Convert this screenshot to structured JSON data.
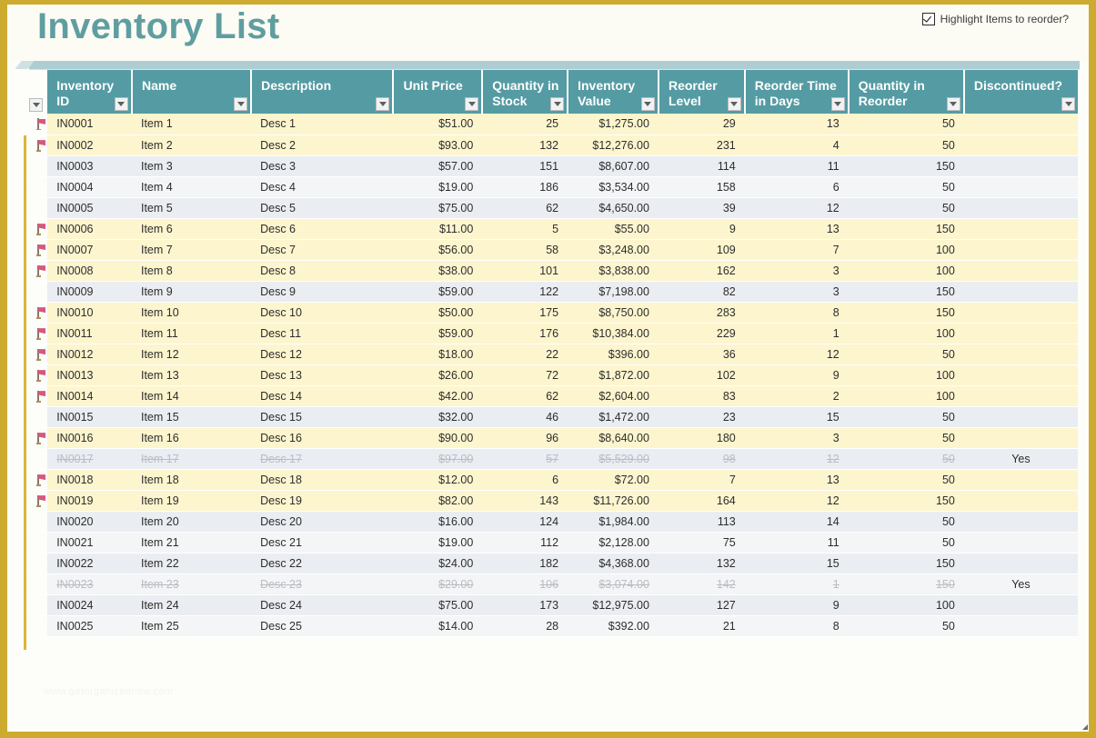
{
  "page": {
    "title": "Inventory List",
    "watermark": "www.getorganizednow.com",
    "accent_teal": "#559ba3",
    "title_color": "#5f9ea0",
    "frame_color": "#cdab2e",
    "highlight_row_color": "#fdf5ce",
    "alt_row_color": "#eaedf1"
  },
  "highlight_toggle": {
    "label": "Highlight Items to reorder?",
    "checked": true,
    "icon": "checkbox-checked-icon"
  },
  "table": {
    "columns": [
      {
        "key": "flag",
        "label": "",
        "align": "center"
      },
      {
        "key": "inventory_id",
        "label": "Inventory ID",
        "align": "left"
      },
      {
        "key": "name",
        "label": "Name",
        "align": "left"
      },
      {
        "key": "description",
        "label": "Description",
        "align": "left"
      },
      {
        "key": "unit_price",
        "label": "Unit Price",
        "align": "right"
      },
      {
        "key": "quantity_in_stock",
        "label": "Quantity in Stock",
        "align": "right"
      },
      {
        "key": "inventory_value",
        "label": "Inventory Value",
        "align": "right"
      },
      {
        "key": "reorder_level",
        "label": "Reorder Level",
        "align": "right"
      },
      {
        "key": "reorder_time_in_days",
        "label": "Reorder Time in Days",
        "align": "right"
      },
      {
        "key": "quantity_in_reorder",
        "label": "Quantity in Reorder",
        "align": "right"
      },
      {
        "key": "discontinued",
        "label": "Discontinued?",
        "align": "center"
      }
    ],
    "filter_icon": "filter-dropdown-icon",
    "flag_icon": "reorder-flag-icon",
    "rows": [
      {
        "flag": true,
        "inventory_id": "IN0001",
        "name": "Item 1",
        "description": "Desc 1",
        "unit_price": "$51.00",
        "quantity_in_stock": "25",
        "inventory_value": "$1,275.00",
        "reorder_level": "29",
        "reorder_time_in_days": "13",
        "quantity_in_reorder": "50",
        "discontinued": "",
        "style": "hl"
      },
      {
        "flag": true,
        "inventory_id": "IN0002",
        "name": "Item 2",
        "description": "Desc 2",
        "unit_price": "$93.00",
        "quantity_in_stock": "132",
        "inventory_value": "$12,276.00",
        "reorder_level": "231",
        "reorder_time_in_days": "4",
        "quantity_in_reorder": "50",
        "discontinued": "",
        "style": "hl"
      },
      {
        "flag": false,
        "inventory_id": "IN0003",
        "name": "Item 3",
        "description": "Desc 3",
        "unit_price": "$57.00",
        "quantity_in_stock": "151",
        "inventory_value": "$8,607.00",
        "reorder_level": "114",
        "reorder_time_in_days": "11",
        "quantity_in_reorder": "150",
        "discontinued": "",
        "style": "alt"
      },
      {
        "flag": false,
        "inventory_id": "IN0004",
        "name": "Item 4",
        "description": "Desc 4",
        "unit_price": "$19.00",
        "quantity_in_stock": "186",
        "inventory_value": "$3,534.00",
        "reorder_level": "158",
        "reorder_time_in_days": "6",
        "quantity_in_reorder": "50",
        "discontinued": "",
        "style": "plain"
      },
      {
        "flag": false,
        "inventory_id": "IN0005",
        "name": "Item 5",
        "description": "Desc 5",
        "unit_price": "$75.00",
        "quantity_in_stock": "62",
        "inventory_value": "$4,650.00",
        "reorder_level": "39",
        "reorder_time_in_days": "12",
        "quantity_in_reorder": "50",
        "discontinued": "",
        "style": "alt"
      },
      {
        "flag": true,
        "inventory_id": "IN0006",
        "name": "Item 6",
        "description": "Desc 6",
        "unit_price": "$11.00",
        "quantity_in_stock": "5",
        "inventory_value": "$55.00",
        "reorder_level": "9",
        "reorder_time_in_days": "13",
        "quantity_in_reorder": "150",
        "discontinued": "",
        "style": "hl"
      },
      {
        "flag": true,
        "inventory_id": "IN0007",
        "name": "Item 7",
        "description": "Desc 7",
        "unit_price": "$56.00",
        "quantity_in_stock": "58",
        "inventory_value": "$3,248.00",
        "reorder_level": "109",
        "reorder_time_in_days": "7",
        "quantity_in_reorder": "100",
        "discontinued": "",
        "style": "hl"
      },
      {
        "flag": true,
        "inventory_id": "IN0008",
        "name": "Item 8",
        "description": "Desc 8",
        "unit_price": "$38.00",
        "quantity_in_stock": "101",
        "inventory_value": "$3,838.00",
        "reorder_level": "162",
        "reorder_time_in_days": "3",
        "quantity_in_reorder": "100",
        "discontinued": "",
        "style": "hl"
      },
      {
        "flag": false,
        "inventory_id": "IN0009",
        "name": "Item 9",
        "description": "Desc 9",
        "unit_price": "$59.00",
        "quantity_in_stock": "122",
        "inventory_value": "$7,198.00",
        "reorder_level": "82",
        "reorder_time_in_days": "3",
        "quantity_in_reorder": "150",
        "discontinued": "",
        "style": "alt"
      },
      {
        "flag": true,
        "inventory_id": "IN0010",
        "name": "Item 10",
        "description": "Desc 10",
        "unit_price": "$50.00",
        "quantity_in_stock": "175",
        "inventory_value": "$8,750.00",
        "reorder_level": "283",
        "reorder_time_in_days": "8",
        "quantity_in_reorder": "150",
        "discontinued": "",
        "style": "hl"
      },
      {
        "flag": true,
        "inventory_id": "IN0011",
        "name": "Item 11",
        "description": "Desc 11",
        "unit_price": "$59.00",
        "quantity_in_stock": "176",
        "inventory_value": "$10,384.00",
        "reorder_level": "229",
        "reorder_time_in_days": "1",
        "quantity_in_reorder": "100",
        "discontinued": "",
        "style": "hl"
      },
      {
        "flag": true,
        "inventory_id": "IN0012",
        "name": "Item 12",
        "description": "Desc 12",
        "unit_price": "$18.00",
        "quantity_in_stock": "22",
        "inventory_value": "$396.00",
        "reorder_level": "36",
        "reorder_time_in_days": "12",
        "quantity_in_reorder": "50",
        "discontinued": "",
        "style": "hl"
      },
      {
        "flag": true,
        "inventory_id": "IN0013",
        "name": "Item 13",
        "description": "Desc 13",
        "unit_price": "$26.00",
        "quantity_in_stock": "72",
        "inventory_value": "$1,872.00",
        "reorder_level": "102",
        "reorder_time_in_days": "9",
        "quantity_in_reorder": "100",
        "discontinued": "",
        "style": "hl"
      },
      {
        "flag": true,
        "inventory_id": "IN0014",
        "name": "Item 14",
        "description": "Desc 14",
        "unit_price": "$42.00",
        "quantity_in_stock": "62",
        "inventory_value": "$2,604.00",
        "reorder_level": "83",
        "reorder_time_in_days": "2",
        "quantity_in_reorder": "100",
        "discontinued": "",
        "style": "hl"
      },
      {
        "flag": false,
        "inventory_id": "IN0015",
        "name": "Item 15",
        "description": "Desc 15",
        "unit_price": "$32.00",
        "quantity_in_stock": "46",
        "inventory_value": "$1,472.00",
        "reorder_level": "23",
        "reorder_time_in_days": "15",
        "quantity_in_reorder": "50",
        "discontinued": "",
        "style": "alt"
      },
      {
        "flag": true,
        "inventory_id": "IN0016",
        "name": "Item 16",
        "description": "Desc 16",
        "unit_price": "$90.00",
        "quantity_in_stock": "96",
        "inventory_value": "$8,640.00",
        "reorder_level": "180",
        "reorder_time_in_days": "3",
        "quantity_in_reorder": "50",
        "discontinued": "",
        "style": "hl"
      },
      {
        "flag": false,
        "inventory_id": "IN0017",
        "name": "Item 17",
        "description": "Desc 17",
        "unit_price": "$97.00",
        "quantity_in_stock": "57",
        "inventory_value": "$5,529.00",
        "reorder_level": "98",
        "reorder_time_in_days": "12",
        "quantity_in_reorder": "50",
        "discontinued": "Yes",
        "style": "alt",
        "discontinued_row": true
      },
      {
        "flag": true,
        "inventory_id": "IN0018",
        "name": "Item 18",
        "description": "Desc 18",
        "unit_price": "$12.00",
        "quantity_in_stock": "6",
        "inventory_value": "$72.00",
        "reorder_level": "7",
        "reorder_time_in_days": "13",
        "quantity_in_reorder": "50",
        "discontinued": "",
        "style": "hl"
      },
      {
        "flag": true,
        "inventory_id": "IN0019",
        "name": "Item 19",
        "description": "Desc 19",
        "unit_price": "$82.00",
        "quantity_in_stock": "143",
        "inventory_value": "$11,726.00",
        "reorder_level": "164",
        "reorder_time_in_days": "12",
        "quantity_in_reorder": "150",
        "discontinued": "",
        "style": "hl"
      },
      {
        "flag": false,
        "inventory_id": "IN0020",
        "name": "Item 20",
        "description": "Desc 20",
        "unit_price": "$16.00",
        "quantity_in_stock": "124",
        "inventory_value": "$1,984.00",
        "reorder_level": "113",
        "reorder_time_in_days": "14",
        "quantity_in_reorder": "50",
        "discontinued": "",
        "style": "alt"
      },
      {
        "flag": false,
        "inventory_id": "IN0021",
        "name": "Item 21",
        "description": "Desc 21",
        "unit_price": "$19.00",
        "quantity_in_stock": "112",
        "inventory_value": "$2,128.00",
        "reorder_level": "75",
        "reorder_time_in_days": "11",
        "quantity_in_reorder": "50",
        "discontinued": "",
        "style": "plain"
      },
      {
        "flag": false,
        "inventory_id": "IN0022",
        "name": "Item 22",
        "description": "Desc 22",
        "unit_price": "$24.00",
        "quantity_in_stock": "182",
        "inventory_value": "$4,368.00",
        "reorder_level": "132",
        "reorder_time_in_days": "15",
        "quantity_in_reorder": "150",
        "discontinued": "",
        "style": "alt"
      },
      {
        "flag": false,
        "inventory_id": "IN0023",
        "name": "Item 23",
        "description": "Desc 23",
        "unit_price": "$29.00",
        "quantity_in_stock": "106",
        "inventory_value": "$3,074.00",
        "reorder_level": "142",
        "reorder_time_in_days": "1",
        "quantity_in_reorder": "150",
        "discontinued": "Yes",
        "style": "plain",
        "discontinued_row": true
      },
      {
        "flag": false,
        "inventory_id": "IN0024",
        "name": "Item 24",
        "description": "Desc 24",
        "unit_price": "$75.00",
        "quantity_in_stock": "173",
        "inventory_value": "$12,975.00",
        "reorder_level": "127",
        "reorder_time_in_days": "9",
        "quantity_in_reorder": "100",
        "discontinued": "",
        "style": "alt"
      },
      {
        "flag": false,
        "inventory_id": "IN0025",
        "name": "Item 25",
        "description": "Desc 25",
        "unit_price": "$14.00",
        "quantity_in_stock": "28",
        "inventory_value": "$392.00",
        "reorder_level": "21",
        "reorder_time_in_days": "8",
        "quantity_in_reorder": "50",
        "discontinued": "",
        "style": "plain"
      }
    ]
  }
}
